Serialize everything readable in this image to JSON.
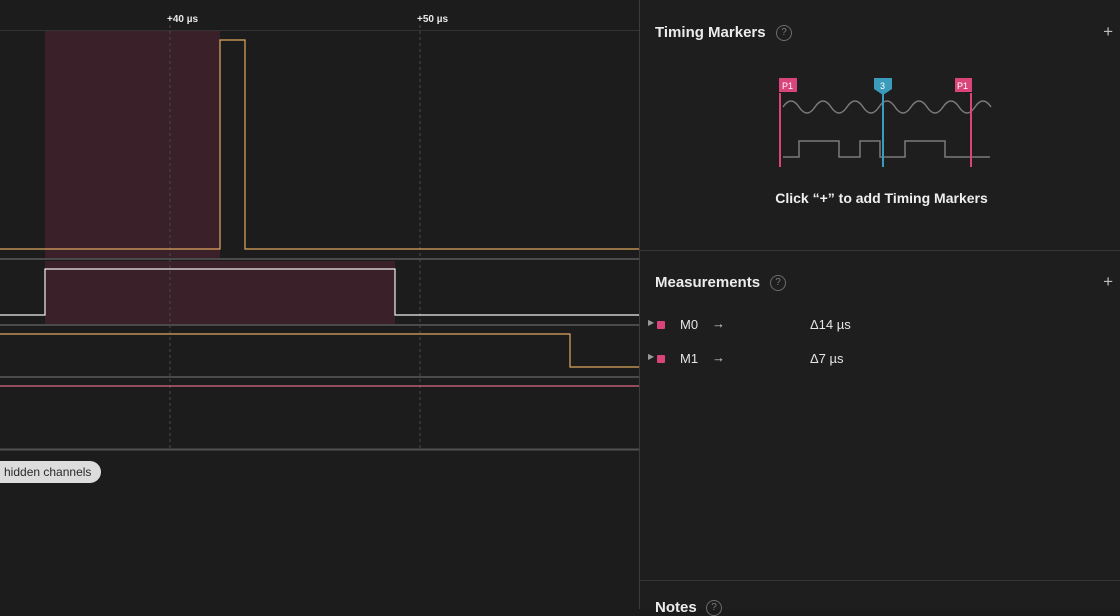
{
  "timeline": {
    "ticks": [
      "+40 µs",
      "+50 µs"
    ],
    "hidden_channels_label": "hidden channels"
  },
  "colors": {
    "background": "#1c1c1d",
    "signal_orange": "#e0a75e",
    "signal_white": "#f0f0f0",
    "signal_pink": "#d96a86",
    "highlight": "#3c2029",
    "marker_pink": "#d9457a",
    "marker_blue": "#3b9bbb"
  },
  "timing_markers": {
    "title": "Timing Markers",
    "help_icon": "question-circle-icon",
    "add_icon": "plus-icon",
    "illustration": {
      "left_flag": "P1",
      "mid_flag": "3",
      "right_flag": "P1"
    },
    "hint": "Click “+” to add Timing Markers"
  },
  "measurements": {
    "title": "Measurements",
    "help_icon": "question-circle-icon",
    "add_icon": "plus-icon",
    "rows": [
      {
        "name": "M0",
        "arrow": "→",
        "value": "Δ14 µs"
      },
      {
        "name": "M1",
        "arrow": "→",
        "value": "Δ7 µs"
      }
    ]
  },
  "notes": {
    "title": "Notes"
  }
}
